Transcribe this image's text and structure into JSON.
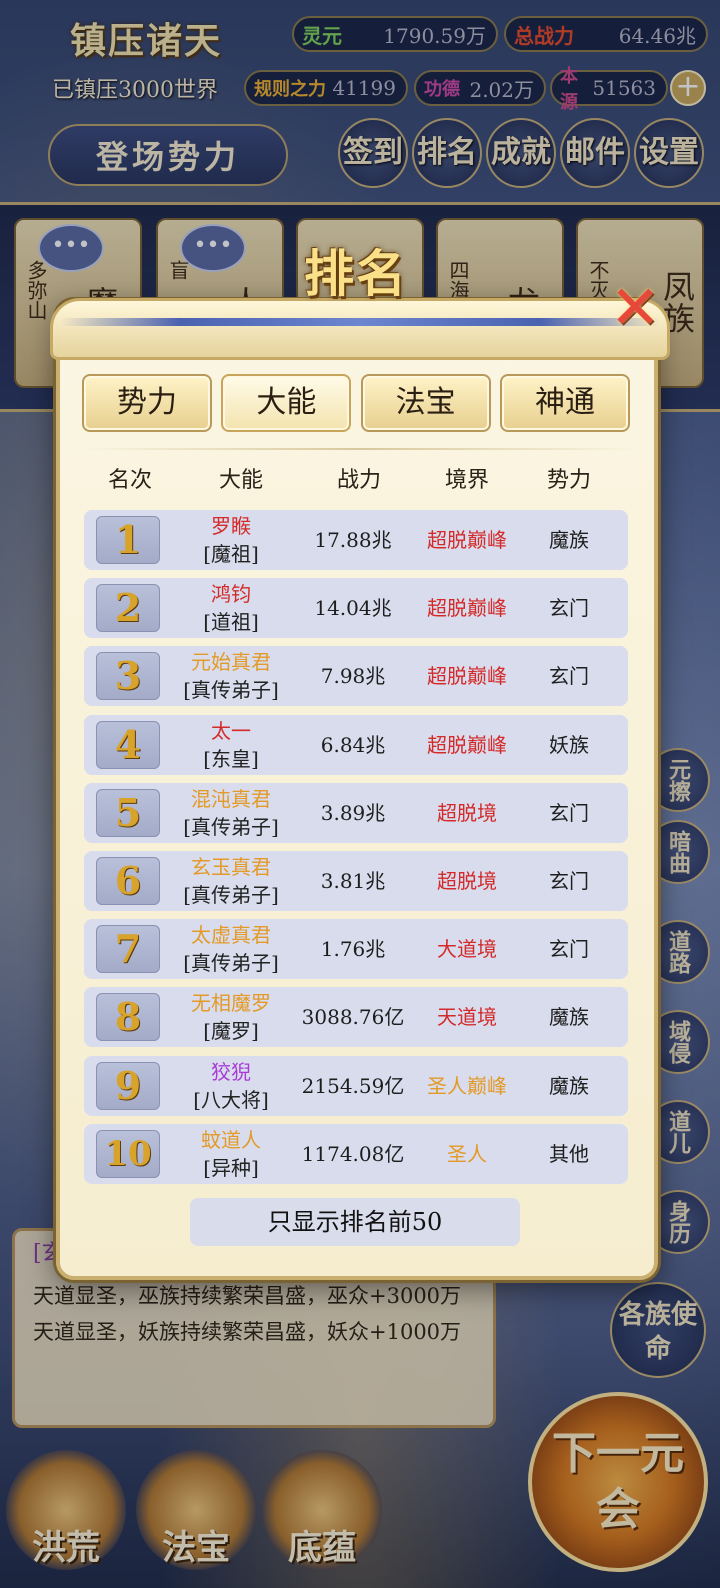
{
  "hud": {
    "title": "镇压诸天",
    "suppressed": "已镇压3000世界",
    "lingyuan_label": "灵元",
    "lingyuan_value": "1790.59万",
    "total_power_label": "总战力",
    "total_power_value": "64.46兆",
    "rule_label": "规则之力",
    "rule_value": "41199",
    "merit_label": "功德",
    "merit_value": "2.02万",
    "origin_label": "本源",
    "origin_value": "51563",
    "plus": "+",
    "debut_button": "登场势力",
    "nav": [
      "签到",
      "排名",
      "成就",
      "邮件",
      "设置"
    ],
    "colors": {
      "lingyuan": "#7fd35a",
      "total_power": "#e84a2a",
      "rule": "#f0b030",
      "merit": "#d04aa8",
      "origin": "#d04a8a"
    }
  },
  "background_cards": [
    {
      "bubble": "•••",
      "vertical": "多弥山",
      "text": "魔"
    },
    {
      "bubble": "•••",
      "vertical": "盲",
      "text": "人"
    },
    {
      "bubble": "",
      "vertical": "",
      "text": ""
    },
    {
      "bubble": "",
      "vertical": "四海",
      "text": "龙"
    },
    {
      "bubble": "",
      "vertical": "不灭",
      "text": "凤族"
    }
  ],
  "dialog": {
    "title": "排名",
    "close": "✕",
    "tabs": [
      "势力",
      "大能",
      "法宝",
      "神通"
    ],
    "active_tab": 1,
    "columns": [
      "名次",
      "大能",
      "战力",
      "境界",
      "势力"
    ],
    "rows": [
      {
        "rank": "1",
        "name": "罗睺",
        "title": "[魔祖]",
        "power": "17.88兆",
        "realm": "超脱巅峰",
        "faction": "魔族",
        "name_color": "#d42a2a",
        "realm_color": "#d42a2a"
      },
      {
        "rank": "2",
        "name": "鸿钧",
        "title": "[道祖]",
        "power": "14.04兆",
        "realm": "超脱巅峰",
        "faction": "玄门",
        "name_color": "#d42a2a",
        "realm_color": "#d42a2a"
      },
      {
        "rank": "3",
        "name": "元始真君",
        "title": "[真传弟子]",
        "power": "7.98兆",
        "realm": "超脱巅峰",
        "faction": "玄门",
        "name_color": "#e39a28",
        "realm_color": "#d42a2a"
      },
      {
        "rank": "4",
        "name": "太一",
        "title": "[东皇]",
        "power": "6.84兆",
        "realm": "超脱巅峰",
        "faction": "妖族",
        "name_color": "#d42a2a",
        "realm_color": "#d42a2a"
      },
      {
        "rank": "5",
        "name": "混沌真君",
        "title": "[真传弟子]",
        "power": "3.89兆",
        "realm": "超脱境",
        "faction": "玄门",
        "name_color": "#e39a28",
        "realm_color": "#d42a2a"
      },
      {
        "rank": "6",
        "name": "玄玉真君",
        "title": "[真传弟子]",
        "power": "3.81兆",
        "realm": "超脱境",
        "faction": "玄门",
        "name_color": "#e39a28",
        "realm_color": "#d42a2a"
      },
      {
        "rank": "7",
        "name": "太虚真君",
        "title": "[真传弟子]",
        "power": "1.76兆",
        "realm": "大道境",
        "faction": "玄门",
        "name_color": "#e39a28",
        "realm_color": "#d42a2a"
      },
      {
        "rank": "8",
        "name": "无相魔罗",
        "title": "[魔罗]",
        "power": "3088.76亿",
        "realm": "天道境",
        "faction": "魔族",
        "name_color": "#e39a28",
        "realm_color": "#d42a2a"
      },
      {
        "rank": "9",
        "name": "狡猊",
        "title": "[八大将]",
        "power": "2154.59亿",
        "realm": "圣人巅峰",
        "faction": "魔族",
        "name_color": "#a83ad8",
        "realm_color": "#e39a28"
      },
      {
        "rank": "10",
        "name": "蚊道人",
        "title": "[异种]",
        "power": "1174.08亿",
        "realm": "圣人",
        "faction": "其他",
        "name_color": "#e39a28",
        "realm_color": "#e39a28"
      }
    ],
    "footer_note": "只显示排名前50"
  },
  "news": {
    "tag": "[玄",
    "lines": [
      "天道显圣，巫族持续繁荣昌盛，巫众+3000万",
      "天道显圣，妖族持续繁荣昌盛，妖众+1000万"
    ]
  },
  "side_buttons": [
    "元擦",
    "暗曲",
    "道路",
    "域侵",
    "道儿",
    "身历"
  ],
  "mission_button": "各族使命",
  "bottom_nav": [
    "洪荒",
    "法宝",
    "底蕴"
  ],
  "next_era_button": "下一元会"
}
